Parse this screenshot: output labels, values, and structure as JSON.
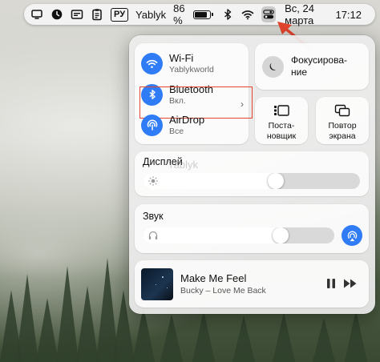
{
  "menubar": {
    "ru_label": "РУ",
    "username": "Yablyk",
    "battery_percent_text": "86 %",
    "battery_level": 0.86,
    "date": "Вс, 24 марта",
    "time": "17:12"
  },
  "control_center": {
    "wifi": {
      "title": "Wi-Fi",
      "subtitle": "Yablykworld"
    },
    "bluetooth": {
      "title": "Bluetooth",
      "subtitle": "Вкл."
    },
    "airdrop": {
      "title": "AirDrop",
      "subtitle": "Все"
    },
    "focus": {
      "label_line1": "Фокусирова-",
      "label_line2": "ние"
    },
    "stage_manager": {
      "line1": "Поста-",
      "line2": "новщик"
    },
    "screen_mirroring": {
      "line1": "Повтор",
      "line2": "экрана"
    },
    "display": {
      "label": "Дисплей",
      "level": 0.62
    },
    "sound": {
      "label": "Звук",
      "level": 0.74
    },
    "now_playing": {
      "title": "Make Me Feel",
      "artist": "Bucky – Love Me Back"
    }
  },
  "watermark": "Yablyk",
  "colors": {
    "accent_blue": "#2f7cf6",
    "annotation_red": "#e3452d"
  }
}
